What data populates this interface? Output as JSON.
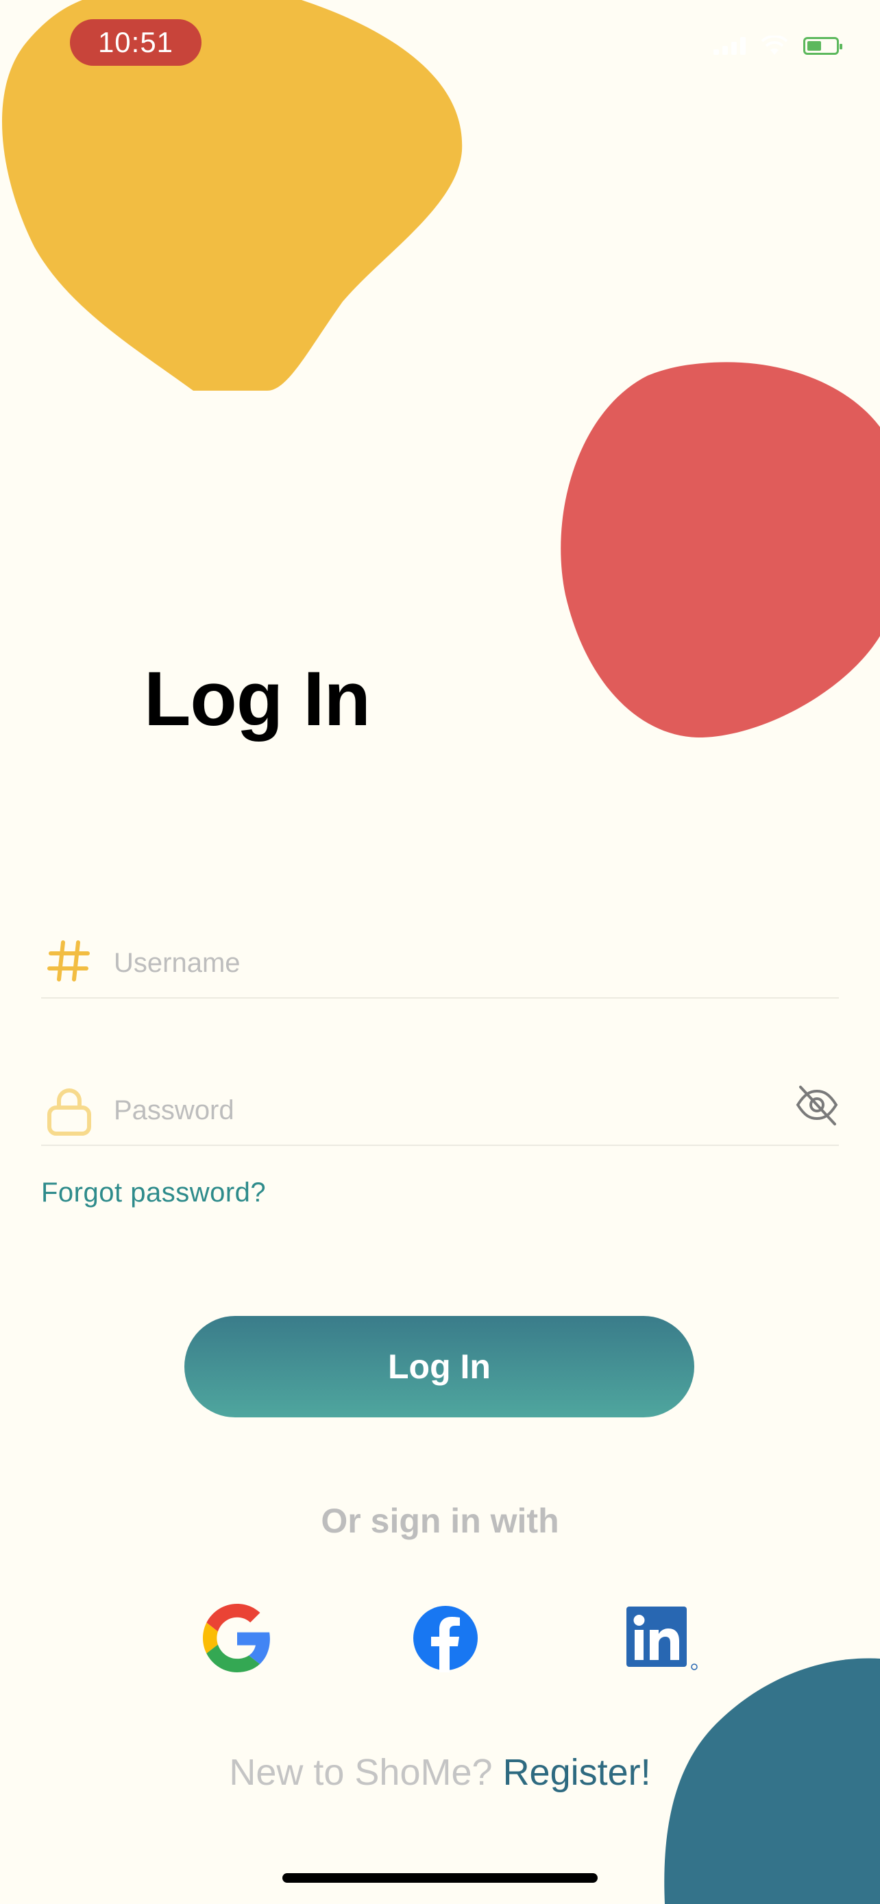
{
  "status_bar": {
    "time": "10:51",
    "icons": [
      "signal-icon",
      "wifi-icon",
      "battery-icon"
    ]
  },
  "colors": {
    "background": "#FFFDF4",
    "yellow_blob": "#F2BD42",
    "red_blob": "#E05C5A",
    "teal_blob": "#34738A",
    "accent": "#2E8B8B",
    "button_gradient_top": "#3A7C8A",
    "button_gradient_bottom": "#4FA69E"
  },
  "login": {
    "title": "Log In",
    "username": {
      "placeholder": "Username",
      "value": "",
      "icon": "hash-icon"
    },
    "password": {
      "placeholder": "Password",
      "value": "",
      "icon": "lock-icon",
      "toggle_icon": "eye-slash-icon"
    },
    "forgot_password": "Forgot password?",
    "submit_label": "Log In",
    "alt_signin": "Or sign in with",
    "social": [
      "google-icon",
      "facebook-icon",
      "linkedin-icon"
    ],
    "register_prefix": "New to ShoMe?",
    "register_link": "Register!"
  }
}
